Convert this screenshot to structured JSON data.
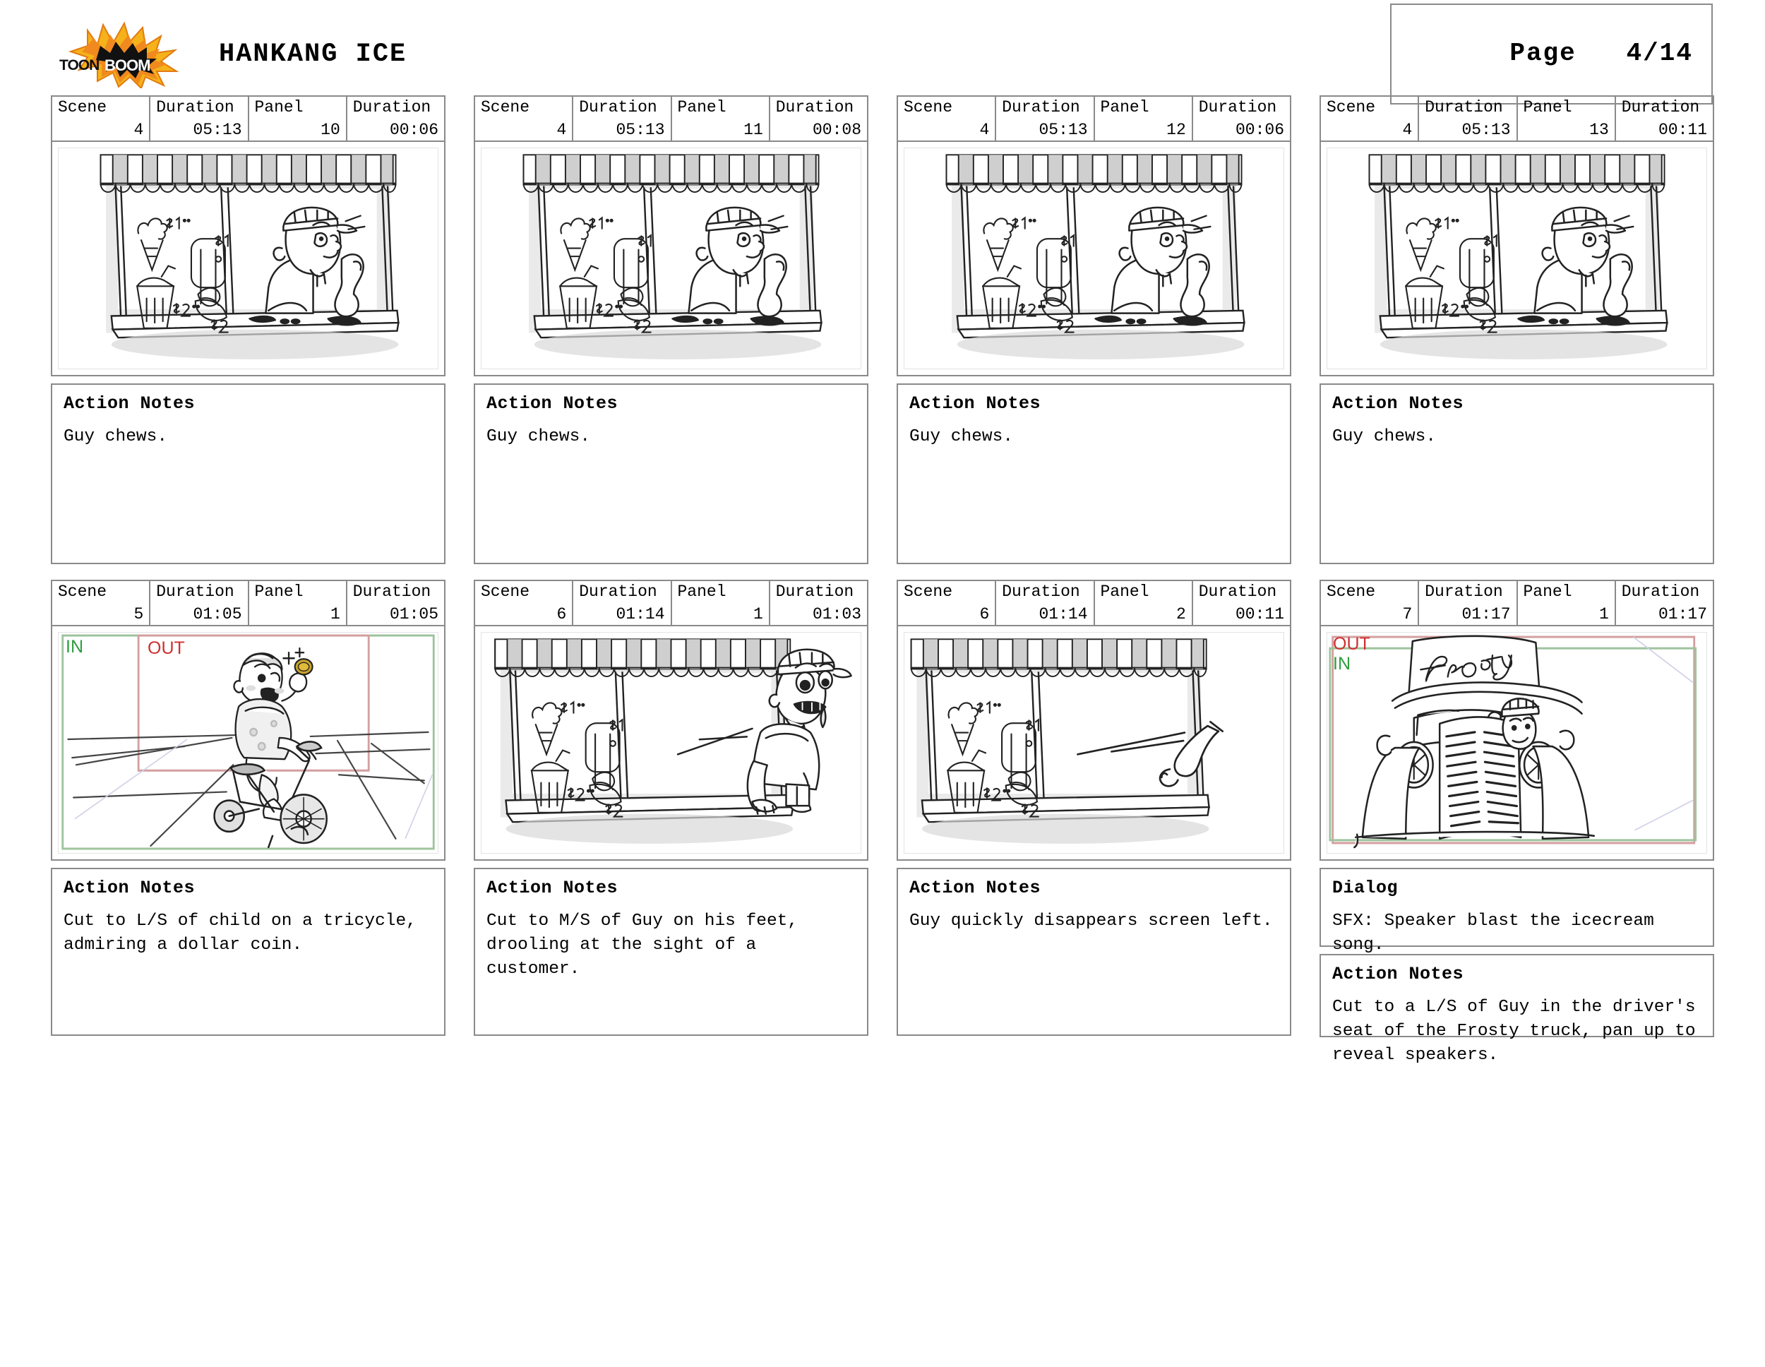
{
  "header": {
    "logo_alt": "toon-boom-logo",
    "logo_text_top": "TOON",
    "logo_text_bottom": "BOOM",
    "show_title": "HANKANG ICE",
    "page_label": "Page",
    "page_value": "4/14"
  },
  "labels": {
    "scene": "Scene",
    "duration": "Duration",
    "panel": "Panel",
    "action_notes": "Action Notes",
    "dialog": "Dialog",
    "in": "IN",
    "out": "OUT"
  },
  "colors": {
    "in_marker": "#2e9e3e",
    "out_marker": "#cf3030",
    "border": "#8a8a8a",
    "logo_orange": "#f08a1e",
    "logo_yellow": "#f5c518"
  },
  "rows": [
    {
      "panels": [
        {
          "scene": "4",
          "scene_duration": "05:13",
          "panel": "10",
          "panel_duration": "00:06",
          "art": "ice-cream-stand-guy-chewing",
          "markers": [],
          "notes": [
            {
              "title": "Action Notes",
              "body": "Guy chews."
            }
          ]
        },
        {
          "scene": "4",
          "scene_duration": "05:13",
          "panel": "11",
          "panel_duration": "00:08",
          "art": "ice-cream-stand-guy-chewing",
          "markers": [],
          "notes": [
            {
              "title": "Action Notes",
              "body": "Guy chews."
            }
          ]
        },
        {
          "scene": "4",
          "scene_duration": "05:13",
          "panel": "12",
          "panel_duration": "00:06",
          "art": "ice-cream-stand-guy-chewing",
          "markers": [],
          "notes": [
            {
              "title": "Action Notes",
              "body": "Guy chews."
            }
          ]
        },
        {
          "scene": "4",
          "scene_duration": "05:13",
          "panel": "13",
          "panel_duration": "00:11",
          "art": "ice-cream-stand-guy-chewing",
          "markers": [],
          "notes": [
            {
              "title": "Action Notes",
              "body": "Guy chews."
            }
          ]
        }
      ]
    },
    {
      "panels": [
        {
          "scene": "5",
          "scene_duration": "01:05",
          "panel": "1",
          "panel_duration": "01:05",
          "art": "child-on-tricycle-with-coin",
          "markers": [
            {
              "type": "in",
              "text": "IN"
            },
            {
              "type": "out",
              "text": "OUT"
            }
          ],
          "notes": [
            {
              "title": "Action Notes",
              "body": "Cut to L/S of child on a tricycle,\nadmiring a dollar coin."
            }
          ]
        },
        {
          "scene": "6",
          "scene_duration": "01:14",
          "panel": "1",
          "panel_duration": "01:03",
          "art": "guy-on-feet-drooling",
          "markers": [],
          "notes": [
            {
              "title": "Action Notes",
              "body": "Cut to M/S of Guy on his feet,\ndrooling at the sight of a customer."
            }
          ]
        },
        {
          "scene": "6",
          "scene_duration": "01:14",
          "panel": "2",
          "panel_duration": "00:11",
          "art": "guy-exits-screen-left",
          "markers": [],
          "notes": [
            {
              "title": "Action Notes",
              "body": "Guy quickly disappears screen left."
            }
          ]
        },
        {
          "scene": "7",
          "scene_duration": "01:17",
          "panel": "1",
          "panel_duration": "01:17",
          "art": "frosty-truck-front",
          "truck_sign": "Frosty",
          "markers": [
            {
              "type": "out",
              "text": "OUT"
            },
            {
              "type": "in",
              "text": "IN"
            }
          ],
          "notes": [
            {
              "title": "Dialog",
              "body": "SFX: Speaker blast the icecream\nsong."
            },
            {
              "title": "Action Notes",
              "body": "Cut to a L/S of Guy in the driver's\nseat of the Frosty truck, pan up to\nreveal speakers."
            }
          ]
        }
      ]
    }
  ]
}
